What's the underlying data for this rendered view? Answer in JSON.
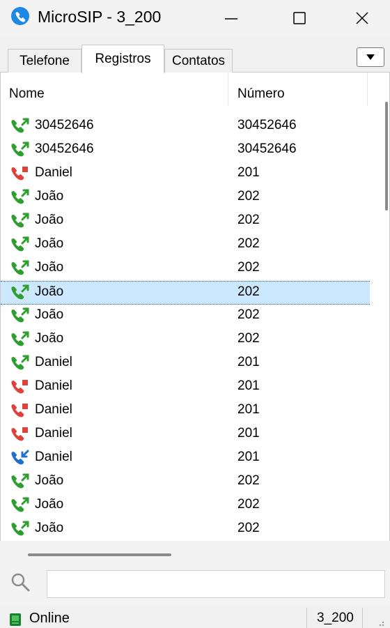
{
  "window": {
    "title": "MicroSIP - 3_200",
    "minimize_symbol": "—",
    "maximize_symbol": "☐",
    "close_symbol": "✕"
  },
  "tabs": [
    {
      "label": "Telefone"
    },
    {
      "label": "Registros",
      "active": true
    },
    {
      "label": "Contatos"
    }
  ],
  "list": {
    "columns": {
      "name": "Nome",
      "number": "Número"
    },
    "rows": [
      {
        "name": "30452646",
        "number": "30452646",
        "call_type": "outgoing",
        "icon": "phone-outgoing-icon"
      },
      {
        "name": "30452646",
        "number": "30452646",
        "call_type": "outgoing",
        "icon": "phone-outgoing-icon"
      },
      {
        "name": "Daniel",
        "number": "201",
        "call_type": "missed",
        "icon": "phone-missed-icon"
      },
      {
        "name": "João",
        "number": "202",
        "call_type": "outgoing",
        "icon": "phone-outgoing-icon"
      },
      {
        "name": "João",
        "number": "202",
        "call_type": "outgoing",
        "icon": "phone-outgoing-icon"
      },
      {
        "name": "João",
        "number": "202",
        "call_type": "outgoing",
        "icon": "phone-outgoing-icon"
      },
      {
        "name": "João",
        "number": "202",
        "call_type": "outgoing",
        "icon": "phone-outgoing-icon"
      },
      {
        "name": "João",
        "number": "202",
        "call_type": "outgoing",
        "icon": "phone-outgoing-icon",
        "selected": true
      },
      {
        "name": "João",
        "number": "202",
        "call_type": "outgoing",
        "icon": "phone-outgoing-icon"
      },
      {
        "name": "João",
        "number": "202",
        "call_type": "outgoing",
        "icon": "phone-outgoing-icon"
      },
      {
        "name": "Daniel",
        "number": "201",
        "call_type": "outgoing",
        "icon": "phone-outgoing-icon"
      },
      {
        "name": "Daniel",
        "number": "201",
        "call_type": "missed",
        "icon": "phone-missed-icon"
      },
      {
        "name": "Daniel",
        "number": "201",
        "call_type": "missed",
        "icon": "phone-missed-icon"
      },
      {
        "name": "Daniel",
        "number": "201",
        "call_type": "missed",
        "icon": "phone-missed-icon"
      },
      {
        "name": "Daniel",
        "number": "201",
        "call_type": "incoming",
        "icon": "phone-incoming-icon"
      },
      {
        "name": "João",
        "number": "202",
        "call_type": "outgoing",
        "icon": "phone-outgoing-icon"
      },
      {
        "name": "João",
        "number": "202",
        "call_type": "outgoing",
        "icon": "phone-outgoing-icon"
      },
      {
        "name": "João",
        "number": "202",
        "call_type": "outgoing",
        "icon": "phone-outgoing-icon"
      }
    ]
  },
  "search": {
    "value": "",
    "placeholder": "",
    "icon": "search-icon"
  },
  "status": {
    "text": "Online",
    "account": "3_200",
    "icon": "online-status-icon"
  },
  "colors": {
    "outgoing": "#2e9e2e",
    "missed": "#e0403a",
    "incoming": "#1f6fd1",
    "selection": "#cce8ff",
    "app_blue": "#1e88e5"
  }
}
